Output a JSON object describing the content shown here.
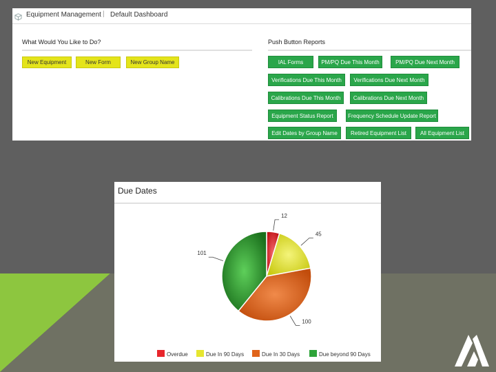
{
  "header": {
    "breadcrumb_app": "Equipment Management",
    "breadcrumb_page": "Default Dashboard"
  },
  "actions": {
    "title": "What Would You Like to Do?",
    "buttons": [
      "New Equipment",
      "New Form",
      "New Group Name"
    ]
  },
  "reports": {
    "title": "Push Button Reports",
    "buttons": [
      "IAL Forms",
      "PM/PQ Due This Month",
      "PM/PQ Due Next Month",
      "Verifications Due This Month",
      "Verifications Due Next Month",
      "Calibrations Due This Month",
      "Calibrations Due Next Month",
      "Equipment Status Report",
      "Frequency Schedule Update Report",
      "Edit Dates by Group Name",
      "Retired Equipment List",
      "All Equipment List"
    ]
  },
  "colors": {
    "yellow_button": "#e4e41a",
    "green_button": "#2aa64a",
    "overdue": "#e8262c",
    "due_90": "#e6e630",
    "due_30": "#e0641a",
    "due_beyond_90": "#2ea43a"
  },
  "icons": [
    "cube-icon",
    "company-logo-icon"
  ],
  "chart_data": {
    "type": "pie",
    "title": "Due Dates",
    "categories": [
      "Overdue",
      "Due In 90 Days",
      "Due In 30 Days",
      "Due beyond 90 Days"
    ],
    "values": [
      12,
      45,
      100,
      101
    ],
    "data_labels": [
      "12",
      "45",
      "100",
      "101"
    ],
    "colors": [
      "#e8262c",
      "#e6e630",
      "#e0641a",
      "#2ea43a"
    ],
    "legend_position": "bottom"
  }
}
